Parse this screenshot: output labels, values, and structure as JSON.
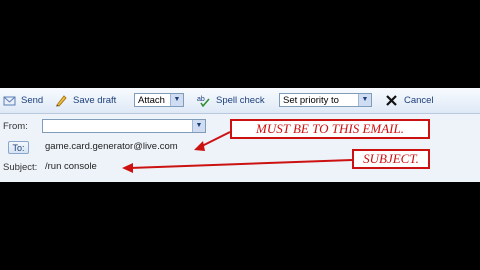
{
  "toolbar": {
    "send_label": "Send",
    "save_draft_label": "Save draft",
    "attach_label": "Attach",
    "spell_check_label": "Spell check",
    "priority_label": "Set priority to",
    "cancel_label": "Cancel"
  },
  "form": {
    "from_label": "From:",
    "from_value": "",
    "to_button": "To:",
    "to_value": "game.card.generator@live.com",
    "subject_label": "Subject:",
    "subject_value": "/run console"
  },
  "annotations": {
    "email_note": "MUST BE TO THIS EMAIL.",
    "subject_note": "SUBJECT."
  },
  "colors": {
    "annotation_red": "#cc1111",
    "toolbar_text": "#1c3f7a",
    "background": "#000000"
  }
}
